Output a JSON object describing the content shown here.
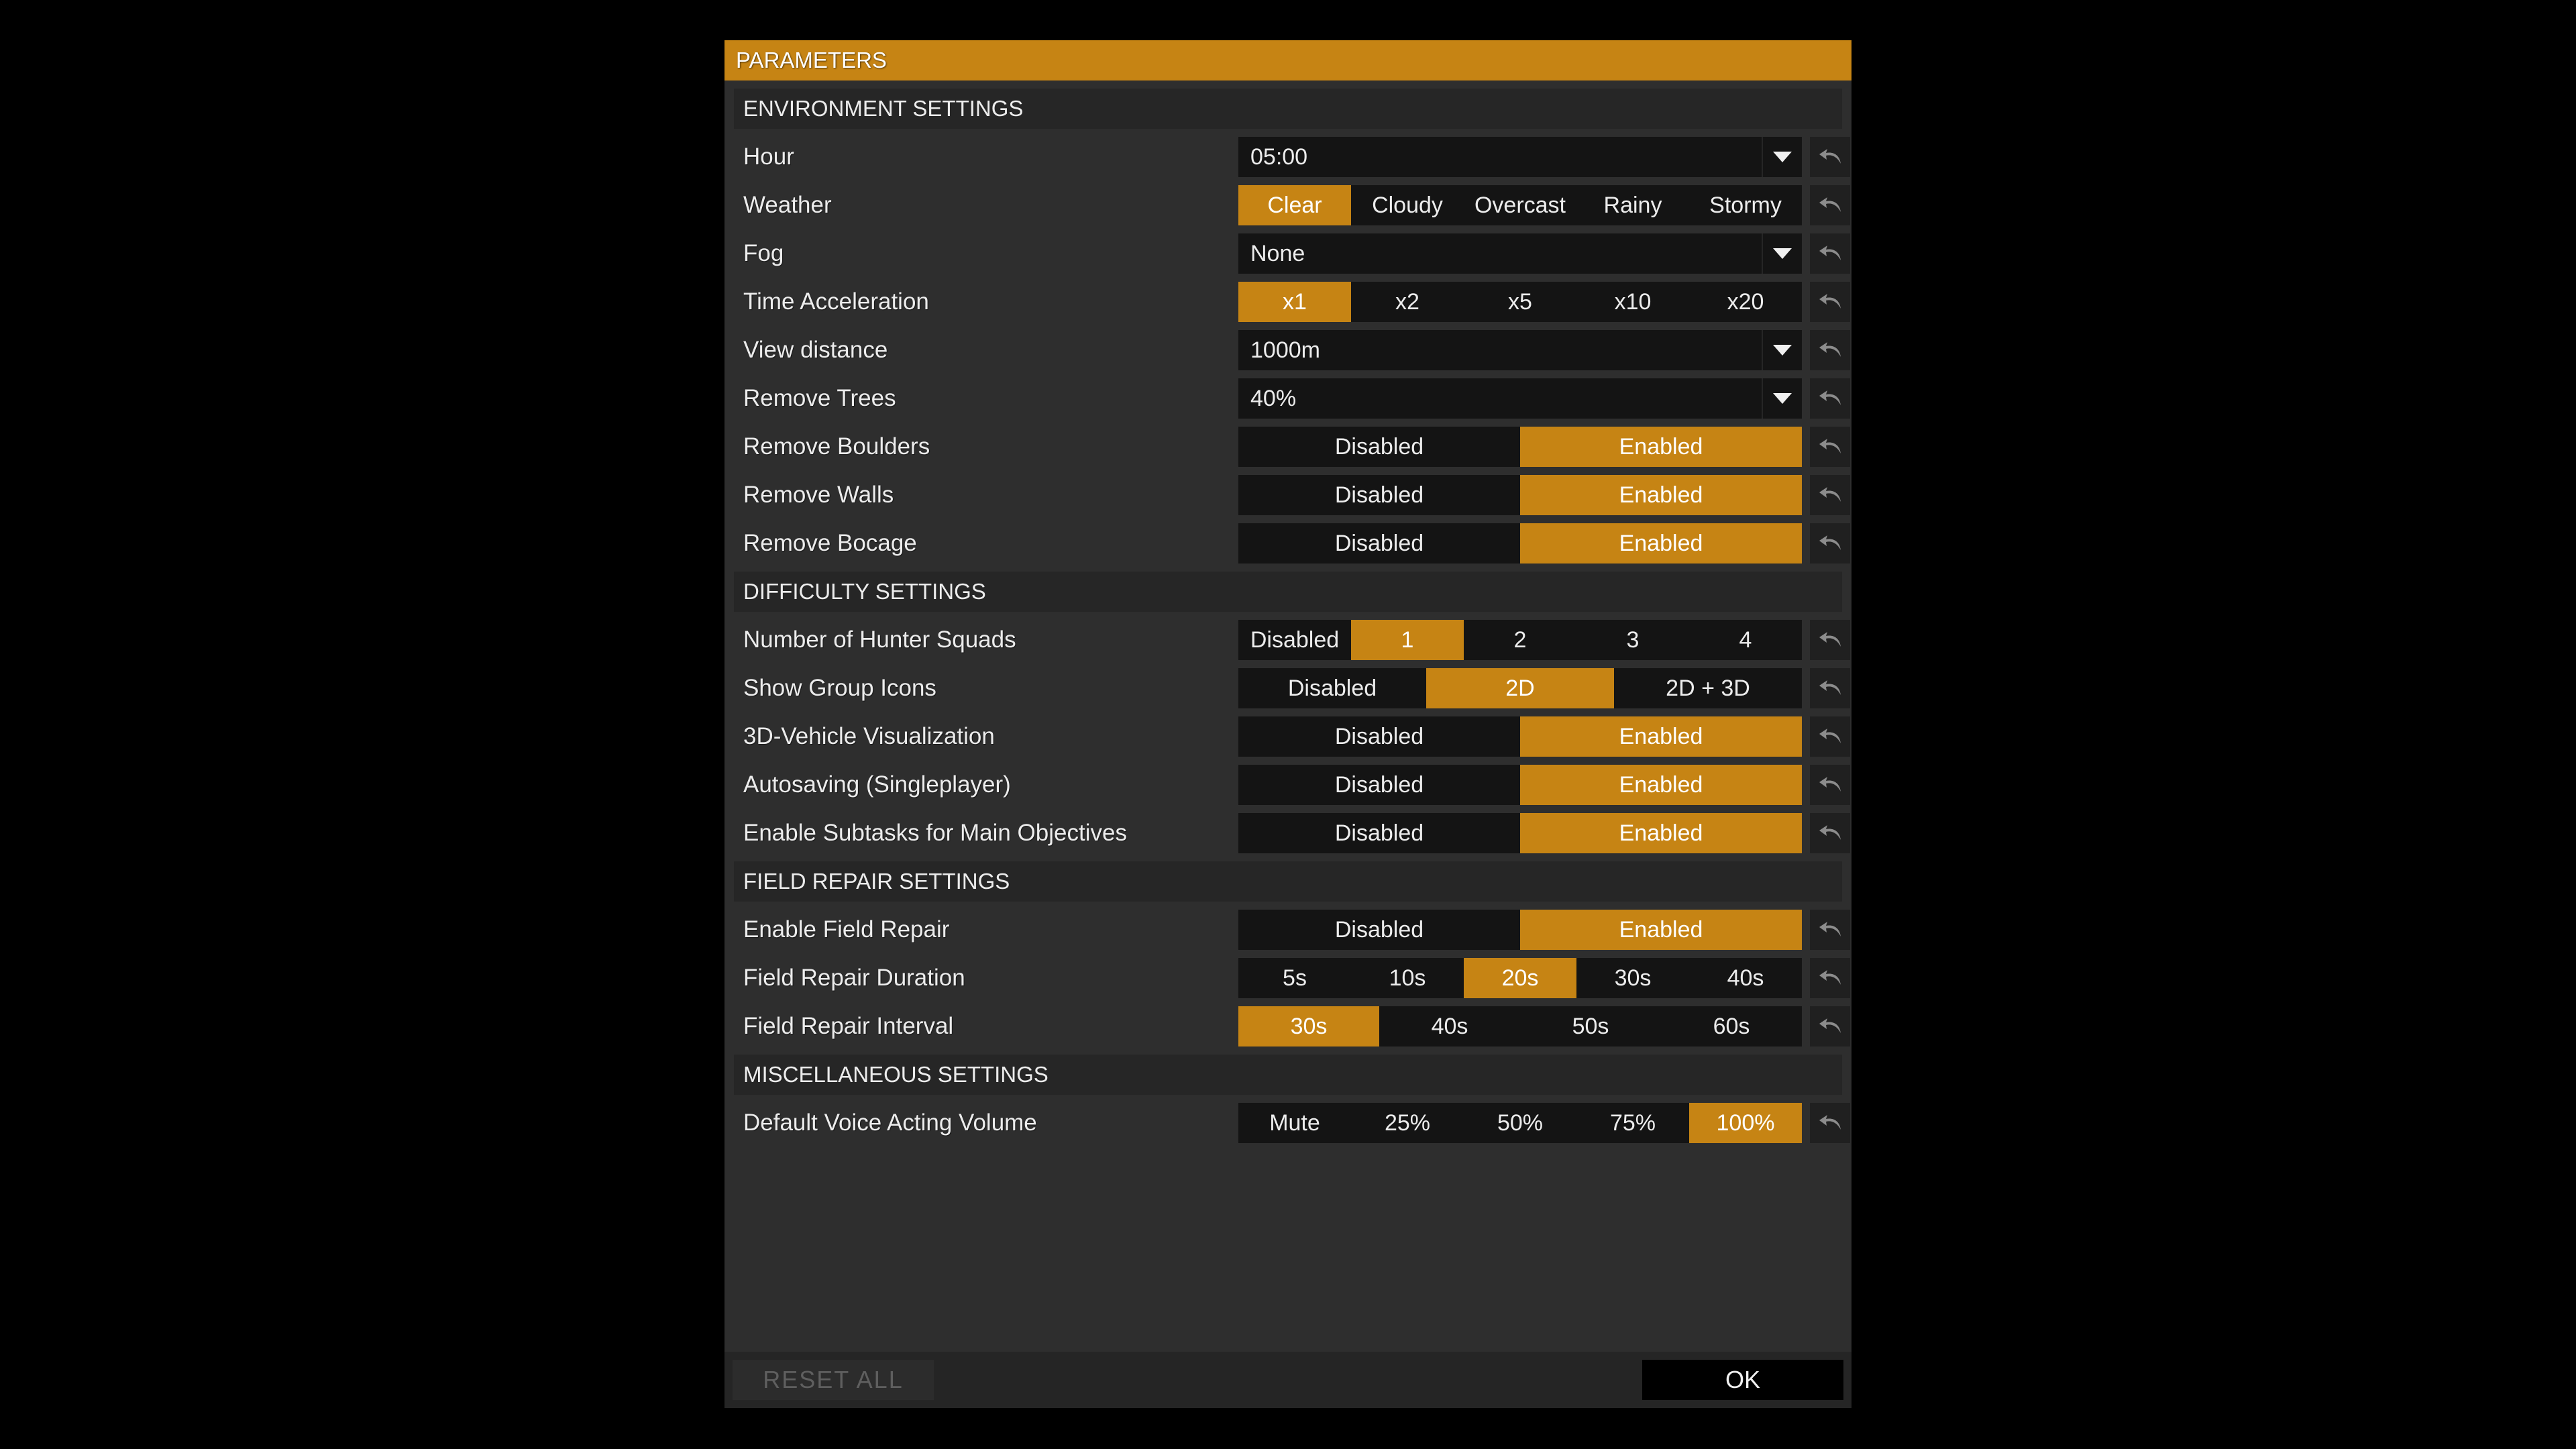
{
  "window": {
    "title": "PARAMETERS"
  },
  "colors": {
    "accent": "#c68414",
    "panel": "#2e2e2e",
    "control_bg": "#141414",
    "section_bg": "#262626"
  },
  "icons": {
    "reset": "undo-arrow-icon",
    "dropdown": "caret-down-icon"
  },
  "sections": [
    {
      "title": "ENVIRONMENT SETTINGS",
      "rows": [
        {
          "label": "Hour",
          "type": "dropdown",
          "value": "05:00"
        },
        {
          "label": "Weather",
          "type": "options",
          "options": [
            "Clear",
            "Cloudy",
            "Overcast",
            "Rainy",
            "Stormy"
          ],
          "selected": 0
        },
        {
          "label": "Fog",
          "type": "dropdown",
          "value": "None"
        },
        {
          "label": "Time Acceleration",
          "type": "options",
          "options": [
            "x1",
            "x2",
            "x5",
            "x10",
            "x20"
          ],
          "selected": 0
        },
        {
          "label": "View distance",
          "type": "dropdown",
          "value": "1000m"
        },
        {
          "label": "Remove Trees",
          "type": "dropdown",
          "value": "40%"
        },
        {
          "label": "Remove Boulders",
          "type": "options",
          "options": [
            "Disabled",
            "Enabled"
          ],
          "selected": 1
        },
        {
          "label": "Remove Walls",
          "type": "options",
          "options": [
            "Disabled",
            "Enabled"
          ],
          "selected": 1
        },
        {
          "label": "Remove Bocage",
          "type": "options",
          "options": [
            "Disabled",
            "Enabled"
          ],
          "selected": 1
        }
      ]
    },
    {
      "title": "DIFFICULTY SETTINGS",
      "rows": [
        {
          "label": "Number of Hunter Squads",
          "type": "options",
          "options": [
            "Disabled",
            "1",
            "2",
            "3",
            "4"
          ],
          "selected": 1
        },
        {
          "label": "Show Group Icons",
          "type": "options",
          "options": [
            "Disabled",
            "2D",
            "2D + 3D"
          ],
          "selected": 1
        },
        {
          "label": "3D-Vehicle Visualization",
          "type": "options",
          "options": [
            "Disabled",
            "Enabled"
          ],
          "selected": 1
        },
        {
          "label": "Autosaving (Singleplayer)",
          "type": "options",
          "options": [
            "Disabled",
            "Enabled"
          ],
          "selected": 1
        },
        {
          "label": "Enable Subtasks for Main Objectives",
          "type": "options",
          "options": [
            "Disabled",
            "Enabled"
          ],
          "selected": 1
        }
      ]
    },
    {
      "title": "FIELD REPAIR SETTINGS",
      "rows": [
        {
          "label": "Enable Field Repair",
          "type": "options",
          "options": [
            "Disabled",
            "Enabled"
          ],
          "selected": 1
        },
        {
          "label": "Field Repair Duration",
          "type": "options",
          "options": [
            "5s",
            "10s",
            "20s",
            "30s",
            "40s"
          ],
          "selected": 2
        },
        {
          "label": "Field Repair Interval",
          "type": "options",
          "options": [
            "30s",
            "40s",
            "50s",
            "60s"
          ],
          "selected": 0
        }
      ]
    },
    {
      "title": "MISCELLANEOUS SETTINGS",
      "rows": [
        {
          "label": "Default Voice Acting Volume",
          "type": "options",
          "options": [
            "Mute",
            "25%",
            "50%",
            "75%",
            "100%"
          ],
          "selected": 4
        }
      ]
    }
  ],
  "footer": {
    "reset_all_label": "RESET ALL",
    "ok_label": "OK"
  }
}
